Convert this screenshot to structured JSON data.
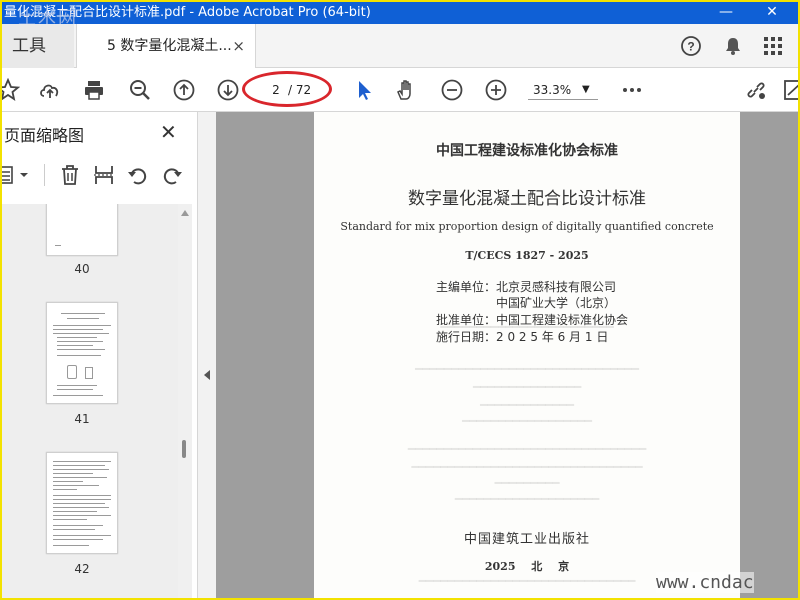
{
  "window": {
    "title": "量化混凝土配合比设计标准.pdf - Adobe Acrobat Pro (64-bit)",
    "watermark_top": "土木网",
    "minimize": "—",
    "close": "✕",
    "brand_color": "#0f60d6",
    "frame_color": "#f3e200"
  },
  "tabs": {
    "tools_label": "工具",
    "doc_tab_label": "5 数字量化混凝土...",
    "doc_tab_close": "×"
  },
  "top_icons": [
    "help-icon",
    "bell-icon",
    "apps-grid-icon"
  ],
  "toolbar": {
    "icons": [
      "star-icon",
      "upload-cloud-icon",
      "print-icon",
      "zoom-out-search-icon",
      "page-up-icon",
      "page-down-icon",
      "select-cursor-icon",
      "hand-icon",
      "zoom-out-icon",
      "zoom-in-icon",
      "more-icon",
      "share-link-icon",
      "comment-icon"
    ],
    "current_page": "2",
    "total_pages": "/ 72",
    "zoom": "33.3%",
    "highlight_color": "#d9262c"
  },
  "left_panel": {
    "title": "页面缩略图",
    "close": "✕",
    "thumbnails": [
      {
        "label": "40"
      },
      {
        "label": "41"
      },
      {
        "label": "42"
      }
    ]
  },
  "document": {
    "org": "中国工程建设标准化协会标准",
    "title": "数字量化混凝土配合比设计标准",
    "title_en": "Standard for mix proportion design of digitally quantified concrete",
    "code": "T/CECS 1827 - 2025",
    "editor_line1": "主编单位：北京灵感科技有限公司",
    "editor_line2": "中国矿业大学（北京）",
    "approver": "批准单位：中国工程建设标准化协会",
    "date": "施行日期：2 0 2 5 年 6 月 1 日",
    "publisher": "中国建筑工业出版社",
    "year_city": "2025 北 京"
  },
  "watermark_bottom": "www.cndac"
}
